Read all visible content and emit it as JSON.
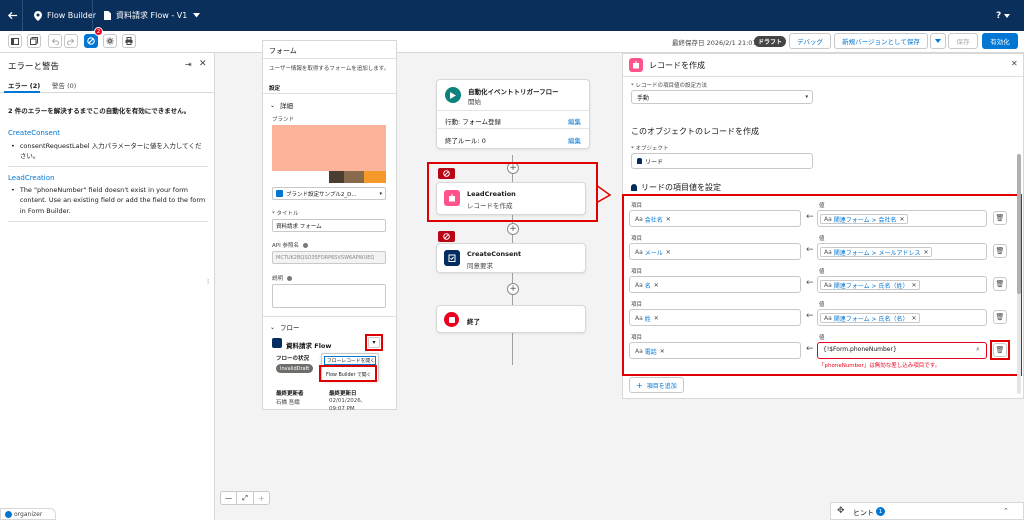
{
  "topbar": {
    "app_name": "Flow Builder",
    "flow_title": "資料請求 Flow - V1",
    "help": "?"
  },
  "toolbar": {
    "badge_count": "2",
    "last_saved": "最終保存日 2026/2/1 21:07",
    "draft": "ドラフト",
    "debug": "デバッグ",
    "save_new_version": "新規バージョンとして保存",
    "save": "保存",
    "activate": "有効化"
  },
  "errors_panel": {
    "title": "エラーと警告",
    "tab_errors": "エラー (2)",
    "tab_warnings": "警告 (0)",
    "summary": "2 件のエラーを解決するまでこの自動化を有効にできません。",
    "items": [
      {
        "link": "CreateConsent",
        "message": "consentRequestLabel 入力パラメーターに値を入力してください。"
      },
      {
        "link": "LeadCreation",
        "message": "The \"phoneNumber\" field doesn't exist in your form content. Use an existing field or add the field to the form in Form Builder."
      }
    ]
  },
  "form_panel": {
    "title": "フォーム",
    "subtitle": "ユーザー情報を取得するフォームを追加します。",
    "tab_settings": "設定",
    "section_details": "詳細",
    "brand_label": "ブランド",
    "brand_colors": [
      "#fbb499",
      "#ffffff",
      "#4a3d34",
      "#8a6a4c",
      "#f59a2a"
    ],
    "brand_select": "ブランド設定サンプル2_D...",
    "title_label": "* タイトル",
    "title_value": "資料請求 フォーム",
    "api_label": "API 参照名",
    "api_value": "MCTUK2BQSO35FORP6SVSW6APWUEQ",
    "desc_label": "説明",
    "section_flow": "フロー",
    "flow_name": "資料請求 Flow",
    "flow_status_label": "フローの状況",
    "flow_status_value": "InvalidDraft",
    "dropdown_item1": "フローレコードを開く",
    "dropdown_item2": "Flow Builder で開く",
    "updated_by_label": "最終更新者",
    "updated_by_value": "石橋 吾織",
    "updated_date_label": "最終更新日",
    "updated_date_value": "02/01/2026, 09:07 PM"
  },
  "flow": {
    "start_title": "自動化イベントトリガーフロー",
    "start_subtitle": "開始",
    "action_label": "行動: フォーム登録",
    "edit1": "編集",
    "end_rules": "終了ルール: 0",
    "edit2": "編集",
    "lead_title": "LeadCreation",
    "lead_subtitle": "レコードを作成",
    "consent_title": "CreateConsent",
    "consent_subtitle": "同意要求",
    "end_title": "終了"
  },
  "record_panel": {
    "title": "レコードを作成",
    "method_label": "* レコードの項目値の設定方法",
    "method_value": "手動",
    "section_object": "このオブジェクトのレコードを作成",
    "object_label": "* オブジェクト",
    "object_value": "リード",
    "section_fields": "リードの項目値を設定",
    "field_label": "項目",
    "value_label": "値",
    "rows": [
      {
        "field": "会社名",
        "value": "関連フォーム > 会社名"
      },
      {
        "field": "メール",
        "value": "関連フォーム > メールアドレス"
      },
      {
        "field": "名",
        "value": "関連フォーム > 氏名（姓）"
      },
      {
        "field": "姓",
        "value": "関連フォーム > 氏名（名）"
      }
    ],
    "phone_field": "電話",
    "phone_value": "{!$Form.phoneNumber}",
    "phone_error": "「phoneNumber」は無効な差し込み項目です。",
    "add_field": "項目を追加"
  },
  "hint": {
    "label": "ヒント",
    "count": "1"
  },
  "zoom": {
    "minus": "—",
    "plus": "+"
  },
  "organizer": "organizer"
}
